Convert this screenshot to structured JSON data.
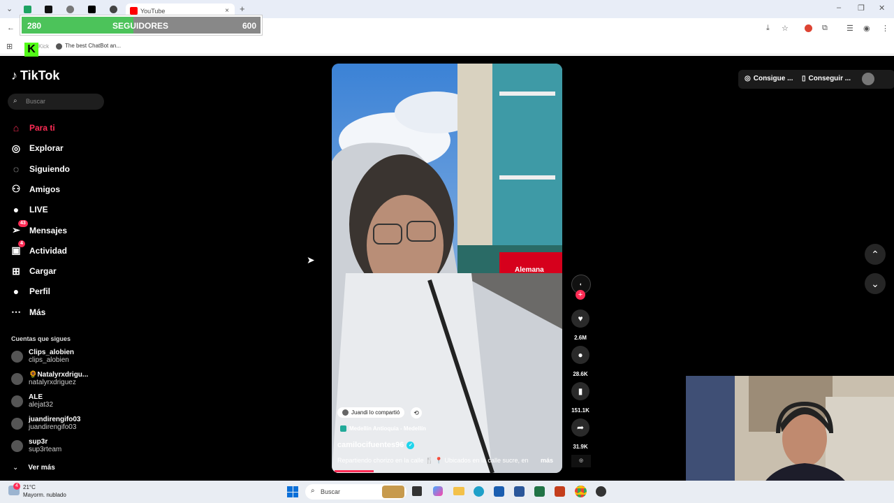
{
  "browser": {
    "tabs": [
      {
        "label": "",
        "icon": "spreadsheet-icon"
      },
      {
        "label": "",
        "icon": "kick-icon"
      },
      {
        "label": "",
        "icon": "audio-icon"
      },
      {
        "label": "",
        "icon": "x-icon"
      },
      {
        "label": "",
        "icon": "chatgpt-icon"
      },
      {
        "label": "YouTube",
        "icon": "youtube-icon"
      }
    ],
    "new_tab": "+",
    "bookmark_text": "The best ChatBot an...",
    "bookmark_prefix": "Kick"
  },
  "followers_overlay": {
    "current": "280",
    "label": "SEGUIDORES",
    "goal": "600",
    "progress_fraction": 0.467
  },
  "tiktok": {
    "logo": "TikTok",
    "search_placeholder": "Buscar",
    "nav": [
      {
        "label": "Para ti",
        "icon": "home-icon",
        "active": true
      },
      {
        "label": "Explorar",
        "icon": "compass-icon"
      },
      {
        "label": "Siguiendo",
        "icon": "following-icon"
      },
      {
        "label": "Amigos",
        "icon": "friends-icon"
      },
      {
        "label": "LIVE",
        "icon": "live-icon"
      },
      {
        "label": "Mensajes",
        "icon": "messages-icon",
        "badge": "43"
      },
      {
        "label": "Actividad",
        "icon": "activity-icon",
        "badge": "4"
      },
      {
        "label": "Cargar",
        "icon": "upload-icon"
      },
      {
        "label": "Perfil",
        "icon": "profile-icon"
      },
      {
        "label": "Más",
        "icon": "more-icon"
      }
    ],
    "following_header": "Cuentas que sigues",
    "accounts": [
      {
        "name": "Clips_alobien",
        "handle": "clips_alobien"
      },
      {
        "name": "🌻Natalyrxdrigu...",
        "handle": "natalyrxdriguez"
      },
      {
        "name": "ALE",
        "handle": "alejat32"
      },
      {
        "name": "juandirengifo03",
        "handle": "juandirengifo03"
      },
      {
        "name": "sup3r",
        "handle": "sup3rteam"
      }
    ],
    "see_more": "Ver más",
    "top_buttons": {
      "btn1": "Consigue ...",
      "btn2": "Conseguir ..."
    },
    "video": {
      "shared_by": "Juandi lo compartió",
      "location": "Medellín Antioquia - Medellín",
      "author": "camilocifuentes96",
      "caption": "Repartiendo chorizo en la calle 🍴 📍 Ubicados en la calle sucre, en",
      "more": "más",
      "store_sign": "Alemana"
    },
    "actions": [
      {
        "icon": "heart-icon",
        "count": "2.6M"
      },
      {
        "icon": "comment-icon",
        "count": "28.6K"
      },
      {
        "icon": "bookmark-icon",
        "count": "151.1K"
      },
      {
        "icon": "share-icon",
        "count": "31.9K"
      }
    ]
  },
  "taskbar": {
    "weather_temp": "21°C",
    "weather_desc": "Mayorm. nublado",
    "weather_badge": "4",
    "search_placeholder": "Buscar"
  }
}
